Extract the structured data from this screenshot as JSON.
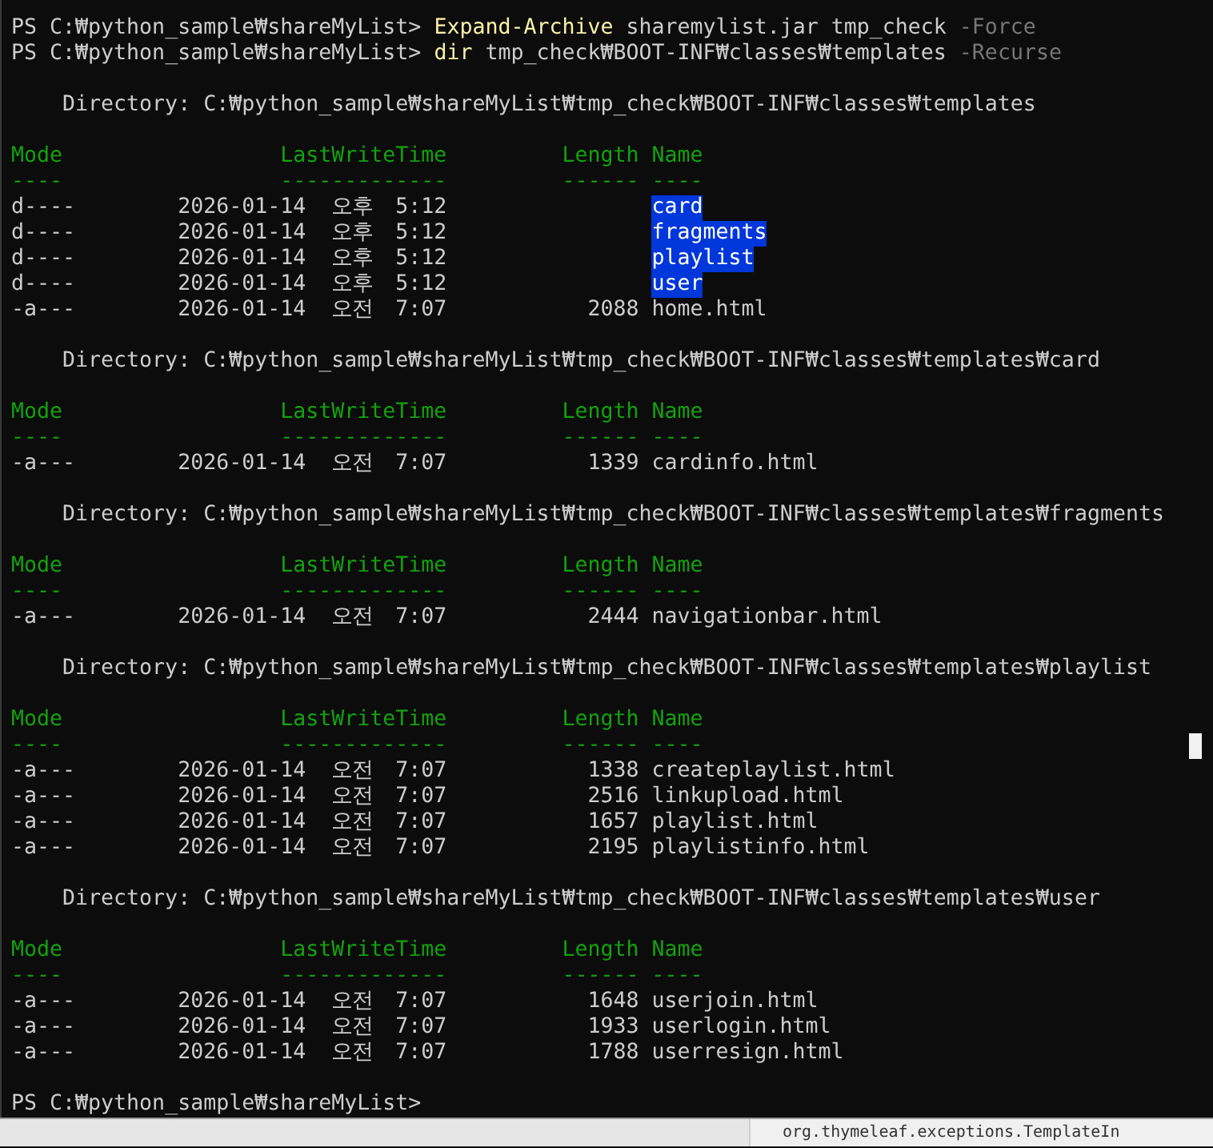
{
  "commands": [
    {
      "prompt": "PS C:₩python_sample₩shareMyList>",
      "command": "Expand-Archive",
      "args": "sharemylist.jar tmp_check",
      "flag": "-Force"
    },
    {
      "prompt": "PS C:₩python_sample₩shareMyList>",
      "command": "dir",
      "args": "tmp_check₩BOOT-INF₩classes₩templates",
      "flag": "-Recurse"
    }
  ],
  "listings": [
    {
      "directory": "Directory: C:₩python_sample₩shareMyList₩tmp_check₩BOOT-INF₩classes₩templates",
      "columns": [
        {
          "label": "Mode",
          "rule": "----"
        },
        {
          "label": "LastWriteTime",
          "rule": "-------------"
        },
        {
          "label": "Length",
          "rule": "------"
        },
        {
          "label": "Name",
          "rule": "----"
        }
      ],
      "rows": [
        {
          "mode": "d----",
          "date": "2026-01-14",
          "ampm": "오후",
          "time": "5:12",
          "name": "card",
          "selected": true
        },
        {
          "mode": "d----",
          "date": "2026-01-14",
          "ampm": "오후",
          "time": "5:12",
          "name": "fragments",
          "selected": true
        },
        {
          "mode": "d----",
          "date": "2026-01-14",
          "ampm": "오후",
          "time": "5:12",
          "name": "playlist",
          "selected": true
        },
        {
          "mode": "d----",
          "date": "2026-01-14",
          "ampm": "오후",
          "time": "5:12",
          "name": "user",
          "selected": true
        },
        {
          "mode": "-a---",
          "date": "2026-01-14",
          "ampm": "오전",
          "time": "7:07",
          "length": "2088",
          "name": "home.html",
          "selected": false
        }
      ]
    },
    {
      "directory": "Directory: C:₩python_sample₩shareMyList₩tmp_check₩BOOT-INF₩classes₩templates₩card",
      "columns": [
        {
          "label": "Mode",
          "rule": "----"
        },
        {
          "label": "LastWriteTime",
          "rule": "-------------"
        },
        {
          "label": "Length",
          "rule": "------"
        },
        {
          "label": "Name",
          "rule": "----"
        }
      ],
      "rows": [
        {
          "mode": "-a---",
          "date": "2026-01-14",
          "ampm": "오전",
          "time": "7:07",
          "length": "1339",
          "name": "cardinfo.html",
          "selected": false
        }
      ]
    },
    {
      "directory": "Directory: C:₩python_sample₩shareMyList₩tmp_check₩BOOT-INF₩classes₩templates₩fragments",
      "columns": [
        {
          "label": "Mode",
          "rule": "----"
        },
        {
          "label": "LastWriteTime",
          "rule": "-------------"
        },
        {
          "label": "Length",
          "rule": "------"
        },
        {
          "label": "Name",
          "rule": "----"
        }
      ],
      "rows": [
        {
          "mode": "-a---",
          "date": "2026-01-14",
          "ampm": "오전",
          "time": "7:07",
          "length": "2444",
          "name": "navigationbar.html",
          "selected": false
        }
      ]
    },
    {
      "directory": "Directory: C:₩python_sample₩shareMyList₩tmp_check₩BOOT-INF₩classes₩templates₩playlist",
      "columns": [
        {
          "label": "Mode",
          "rule": "----"
        },
        {
          "label": "LastWriteTime",
          "rule": "-------------"
        },
        {
          "label": "Length",
          "rule": "------"
        },
        {
          "label": "Name",
          "rule": "----"
        }
      ],
      "rows": [
        {
          "mode": "-a---",
          "date": "2026-01-14",
          "ampm": "오전",
          "time": "7:07",
          "length": "1338",
          "name": "createplaylist.html",
          "selected": false
        },
        {
          "mode": "-a---",
          "date": "2026-01-14",
          "ampm": "오전",
          "time": "7:07",
          "length": "2516",
          "name": "linkupload.html",
          "selected": false
        },
        {
          "mode": "-a---",
          "date": "2026-01-14",
          "ampm": "오전",
          "time": "7:07",
          "length": "1657",
          "name": "playlist.html",
          "selected": false
        },
        {
          "mode": "-a---",
          "date": "2026-01-14",
          "ampm": "오전",
          "time": "7:07",
          "length": "2195",
          "name": "playlistinfo.html",
          "selected": false
        }
      ]
    },
    {
      "directory": "Directory: C:₩python_sample₩shareMyList₩tmp_check₩BOOT-INF₩classes₩templates₩user",
      "columns": [
        {
          "label": "Mode",
          "rule": "----"
        },
        {
          "label": "LastWriteTime",
          "rule": "-------------"
        },
        {
          "label": "Length",
          "rule": "------"
        },
        {
          "label": "Name",
          "rule": "----"
        }
      ],
      "rows": [
        {
          "mode": "-a---",
          "date": "2026-01-14",
          "ampm": "오전",
          "time": "7:07",
          "length": "1648",
          "name": "userjoin.html",
          "selected": false
        },
        {
          "mode": "-a---",
          "date": "2026-01-14",
          "ampm": "오전",
          "time": "7:07",
          "length": "1933",
          "name": "userlogin.html",
          "selected": false
        },
        {
          "mode": "-a---",
          "date": "2026-01-14",
          "ampm": "오전",
          "time": "7:07",
          "length": "1788",
          "name": "userresign.html",
          "selected": false
        }
      ]
    }
  ],
  "final_prompt": "PS C:₩python_sample₩shareMyList>",
  "log_panel": {
    "text": "org.thymeleaf.exceptions.TemplateIn"
  }
}
